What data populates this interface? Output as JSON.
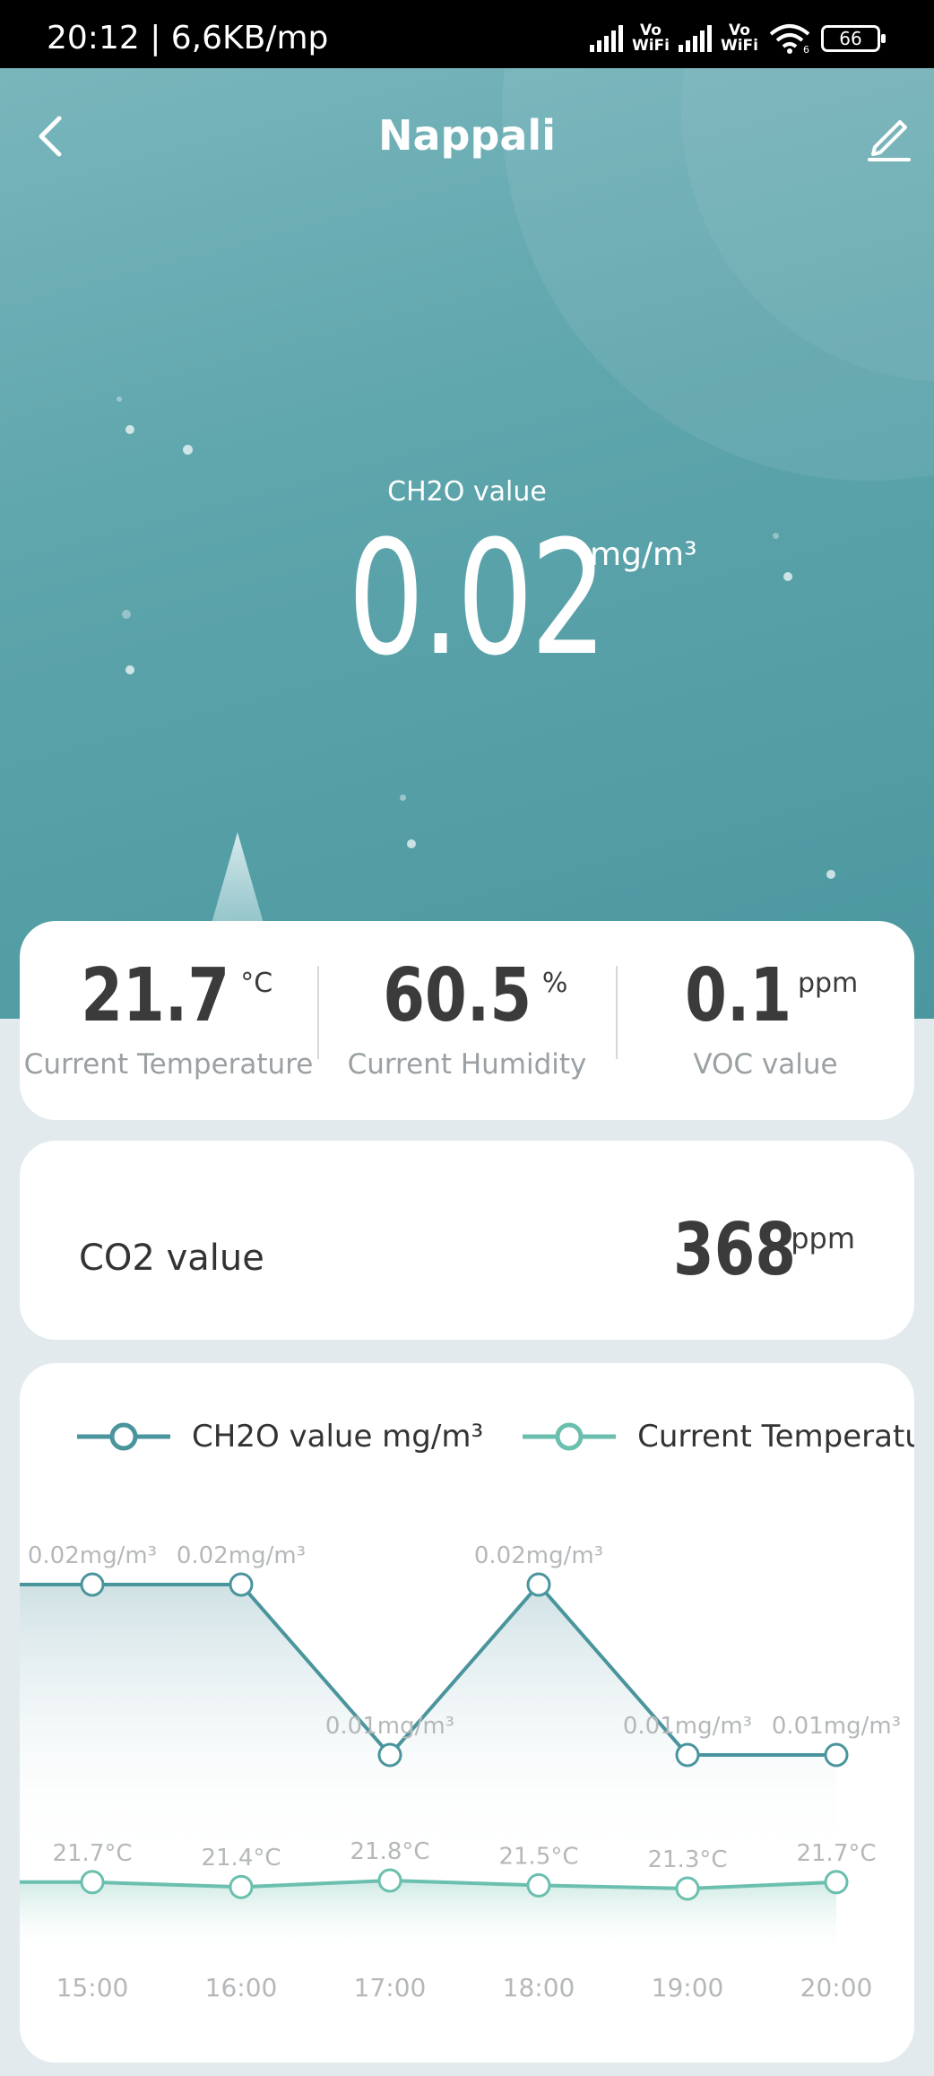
{
  "status_bar": {
    "time": "20:12 | 6,6KB/mp",
    "vowifi_1": "Vo\nWiFi",
    "vowifi_2": "Vo\nWiFi",
    "wifi_label": "6",
    "battery": "66"
  },
  "header": {
    "title": "Nappali"
  },
  "main": {
    "label": "CH2O value",
    "value": "0.02",
    "unit": "mg/m³"
  },
  "metrics": [
    {
      "value": "21.7",
      "unit": "°C",
      "label": "Current Temperature"
    },
    {
      "value": "60.5",
      "unit": "%",
      "label": "Current Humidity"
    },
    {
      "value": "0.1",
      "unit": "ppm",
      "label": "VOC value"
    }
  ],
  "co2": {
    "label": "CO2 value",
    "value": "368",
    "unit": "ppm"
  },
  "colors": {
    "ch2o": "#4a959d",
    "temperature": "#6bbfae",
    "hero": "#5ea5ac"
  },
  "chart_data": {
    "type": "line",
    "categories": [
      "15:00",
      "16:00",
      "17:00",
      "18:00",
      "19:00",
      "20:00"
    ],
    "series": [
      {
        "name": "CH2O value mg/m³",
        "values": [
          0.02,
          0.02,
          0.01,
          0.02,
          0.01,
          0.01
        ],
        "labels": [
          "0.02mg/m³",
          "0.02mg/m³",
          "0.01mg/m³",
          "0.02mg/m³",
          "0.01mg/m³",
          "0.01mg/m³"
        ]
      },
      {
        "name": "Current Temperature",
        "values": [
          21.7,
          21.4,
          21.8,
          21.5,
          21.3,
          21.7
        ],
        "labels": [
          "21.7°C",
          "21.4°C",
          "21.8°C",
          "21.5°C",
          "21.3°C",
          "21.7°C"
        ]
      }
    ]
  }
}
